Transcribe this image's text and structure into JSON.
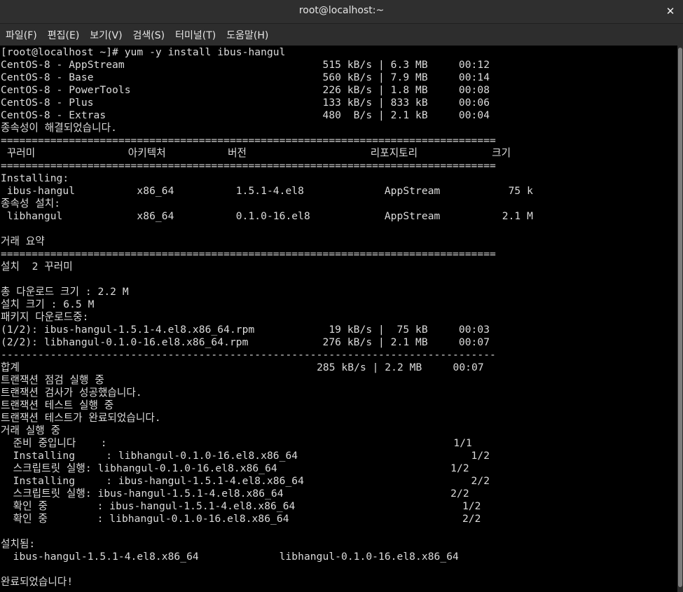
{
  "window": {
    "title": "root@localhost:~",
    "close_label": "✕"
  },
  "menu": {
    "items": [
      "파일(F)",
      "편집(E)",
      "보기(V)",
      "검색(S)",
      "터미널(T)",
      "도움말(H)"
    ]
  },
  "terminal": {
    "lines": [
      "[root@localhost ~]# yum -y install ibus-hangul",
      "CentOS-8 - AppStream                                515 kB/s | 6.3 MB     00:12",
      "CentOS-8 - Base                                     560 kB/s | 7.9 MB     00:14",
      "CentOS-8 - PowerTools                               226 kB/s | 1.8 MB     00:08",
      "CentOS-8 - Plus                                     133 kB/s | 833 kB     00:06",
      "CentOS-8 - Extras                                   480  B/s | 2.1 kB     00:04",
      "종속성이 해결되었습니다.",
      "================================================================================",
      " 꾸러미               아키텍처          버전                    리포지토리            크기",
      "================================================================================",
      "Installing:",
      " ibus-hangul          x86_64          1.5.1-4.el8             AppStream           75 k",
      "종속성 설치:",
      " libhangul            x86_64          0.1.0-16.el8            AppStream          2.1 M",
      "",
      "거래 요약",
      "================================================================================",
      "설치  2 꾸러미",
      "",
      "총 다운로드 크기 : 2.2 M",
      "설치 크기 : 6.5 M",
      "패키지 다운로드중:",
      "(1/2): ibus-hangul-1.5.1-4.el8.x86_64.rpm            19 kB/s |  75 kB     00:03",
      "(2/2): libhangul-0.1.0-16.el8.x86_64.rpm            276 kB/s | 2.1 MB     00:07",
      "--------------------------------------------------------------------------------",
      "합계                                                285 kB/s | 2.2 MB     00:07",
      "트랜잭션 점검 실행 중",
      "트랜잭션 검사가 성공했습니다.",
      "트랜잭션 테스트 실행 중",
      "트랜잭션 테스트가 완료되었습니다.",
      "거래 실행 중",
      "  준비 중입니다    :                                                        1/1",
      "  Installing     : libhangul-0.1.0-16.el8.x86_64                            1/2",
      "  스크립트릿 실행: libhangul-0.1.0-16.el8.x86_64                            1/2",
      "  Installing     : ibus-hangul-1.5.1-4.el8.x86_64                           2/2",
      "  스크립트릿 실행: ibus-hangul-1.5.1-4.el8.x86_64                           2/2",
      "  확인 중        : ibus-hangul-1.5.1-4.el8.x86_64                           1/2",
      "  확인 중        : libhangul-0.1.0-16.el8.x86_64                            2/2",
      "",
      "설치됨:",
      "  ibus-hangul-1.5.1-4.el8.x86_64             libhangul-0.1.0-16.el8.x86_64",
      "",
      "완료되었습니다!"
    ]
  },
  "colors": {
    "terminal_bg": "#000000",
    "terminal_fg": "#dcdcdc",
    "chrome_bg": "#2e2e2e"
  }
}
